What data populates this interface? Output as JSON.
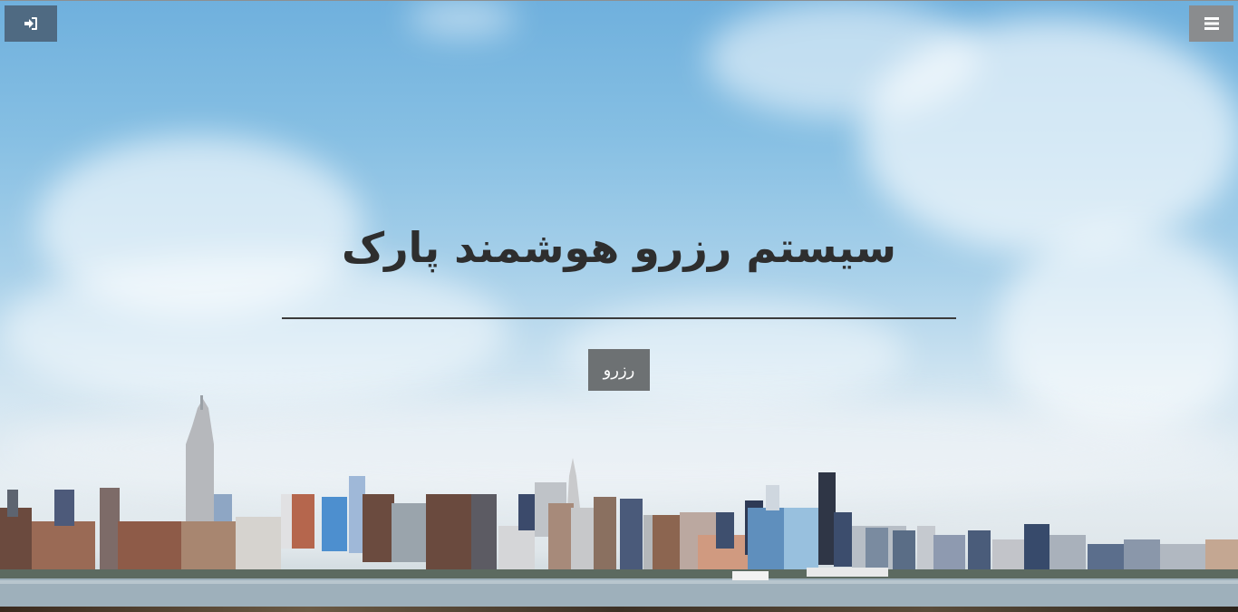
{
  "header": {
    "login_icon": "sign-in-icon",
    "menu_icon": "hamburger-menu-icon"
  },
  "hero": {
    "title": "سیستم رزرو هوشمند پارک",
    "button_label": "رزرو"
  },
  "colors": {
    "login_button": "#4f6a82",
    "menu_button": "#8a8c8e",
    "reserve_button": "#6d7173",
    "title_text": "#2e2e2e",
    "sky_top": "#6fb0dd"
  }
}
